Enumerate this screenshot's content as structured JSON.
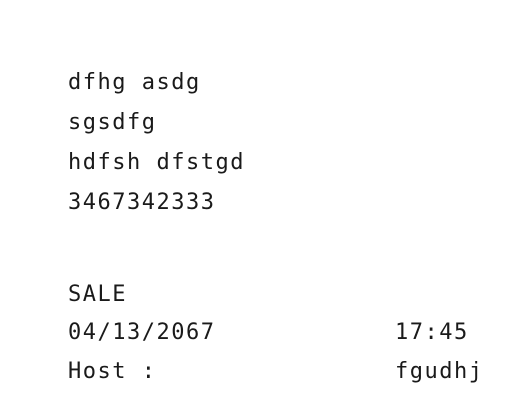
{
  "receipt": {
    "header_lines": [
      "dfhg asdg",
      "sgsdfg",
      "hdfsh dfstgd",
      "3467342333"
    ],
    "transaction_type": "SALE",
    "date": "04/13/2067",
    "time": "17:45",
    "host_label": "Host :",
    "host_value": "fgudhj"
  }
}
